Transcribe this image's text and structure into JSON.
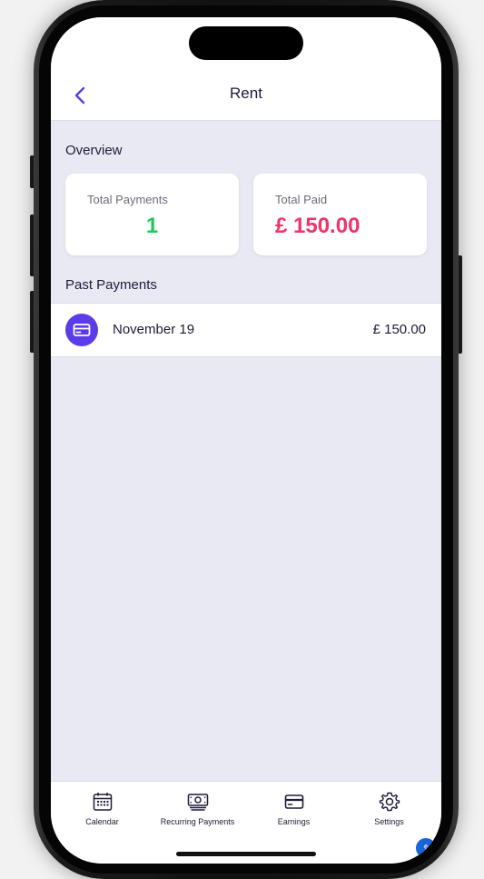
{
  "header": {
    "title": "Rent",
    "back_icon": "chevron-left-icon"
  },
  "overview": {
    "label": "Overview",
    "total_payments": {
      "label": "Total Payments",
      "value": "1",
      "color": "#22c55e"
    },
    "total_paid": {
      "label": "Total Paid",
      "value": "£ 150.00",
      "color": "#f0346b"
    }
  },
  "past_payments": {
    "label": "Past Payments",
    "items": [
      {
        "icon": "credit-card-icon",
        "date": "November 19",
        "amount": "£ 150.00"
      }
    ]
  },
  "tabbar": {
    "tabs": [
      {
        "icon": "calendar-icon",
        "label": "Calendar"
      },
      {
        "icon": "cash-icon",
        "label": "Recurring Payments"
      },
      {
        "icon": "credit-card-icon",
        "label": "Earnings"
      },
      {
        "icon": "gear-icon",
        "label": "Settings"
      }
    ]
  },
  "colors": {
    "accent": "#5b3ce6",
    "background": "#e9e9f3",
    "text": "#1f1b3a"
  }
}
